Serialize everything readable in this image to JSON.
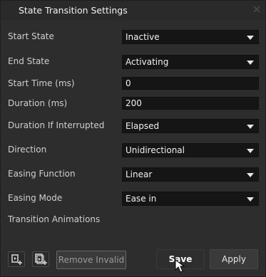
{
  "window": {
    "title": "State Transition Settings",
    "close_icon": "close-icon"
  },
  "rows": [
    {
      "label": "Start State",
      "value": "Inactive",
      "type": "dropdown"
    },
    {
      "label": "End State",
      "value": "Activating",
      "type": "dropdown"
    },
    {
      "label": "Start Time (ms)",
      "value": "0",
      "type": "text"
    },
    {
      "label": "Duration (ms)",
      "value": "200",
      "type": "text"
    },
    {
      "label": "Duration If Interrupted",
      "value": "Elapsed",
      "type": "dropdown"
    },
    {
      "label": "Direction",
      "value": "Unidirectional",
      "type": "dropdown"
    },
    {
      "label": "Easing Function",
      "value": "Linear",
      "type": "dropdown"
    },
    {
      "label": "Easing Mode",
      "value": "Ease in",
      "type": "dropdown"
    }
  ],
  "section": {
    "transition_animations": "Transition Animations"
  },
  "footer": {
    "remove_invalid": "Remove Invalid",
    "save": "Save",
    "apply": "Apply"
  },
  "icons": {
    "add_animation": "add-animation-icon",
    "add_animation_alt": "add-animation-group-icon",
    "cursor": "mouse-pointer-icon"
  }
}
